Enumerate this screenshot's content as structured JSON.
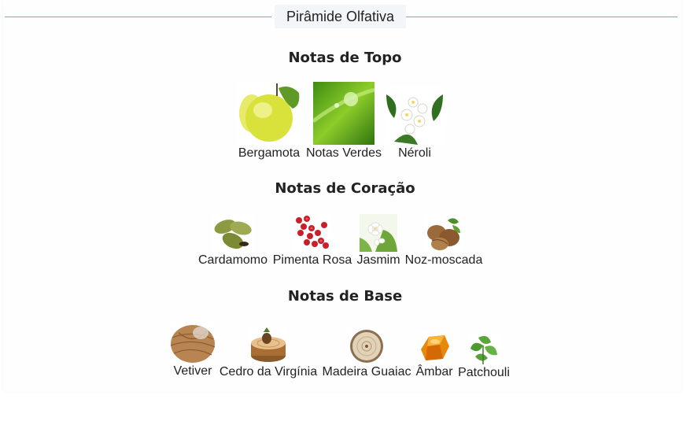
{
  "header": {
    "title": "Pirâmide Olfativa"
  },
  "sections": [
    {
      "title": "Notas de Topo",
      "notes": [
        "Bergamota",
        "Notas Verdes",
        "Néroli"
      ]
    },
    {
      "title": "Notas de Coração",
      "notes": [
        "Cardamomo",
        "Pimenta Rosa",
        "Jasmim",
        "Noz-moscada"
      ]
    },
    {
      "title": "Notas de Base",
      "notes": [
        "Vetiver",
        "Cedro da Virgínia",
        "Madeira Guaiac",
        "Âmbar",
        "Patchouli"
      ]
    }
  ],
  "icons": {
    "bergamota": "bergamot-icon",
    "notas_verdes": "green-leaf-dew-icon",
    "neroli": "orange-blossom-icon",
    "cardamomo": "cardamom-icon",
    "pimenta_rosa": "pink-pepper-icon",
    "jasmim": "jasmine-icon",
    "noz_moscada": "nutmeg-icon",
    "vetiver": "vetiver-icon",
    "cedro": "cedar-icon",
    "guaiac": "guaiac-wood-icon",
    "ambar": "amber-icon",
    "patchouli": "patchouli-icon"
  }
}
